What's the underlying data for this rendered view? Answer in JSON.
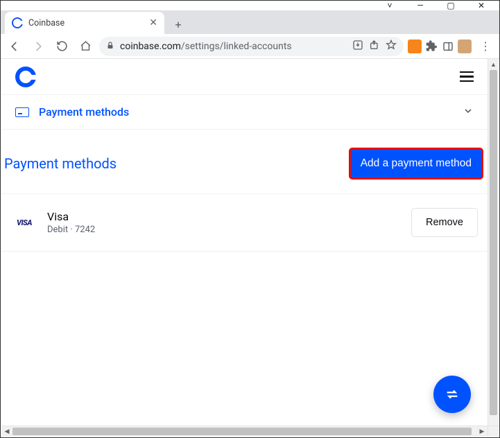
{
  "browser": {
    "tab_title": "Coinbase",
    "url_domain": "coinbase.com",
    "url_path": "/settings/linked-accounts"
  },
  "header": {
    "section_label": "Payment methods"
  },
  "body": {
    "title": "Payment methods",
    "add_button": "Add a payment method"
  },
  "payment_method": {
    "brand": "VISA",
    "name": "Visa",
    "subtitle": "Debit · 7242",
    "remove_label": "Remove"
  }
}
